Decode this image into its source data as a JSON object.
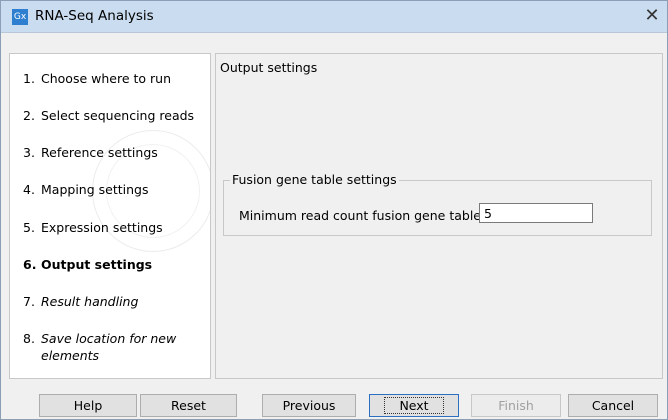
{
  "window": {
    "app_logo": "Gx",
    "title": "RNA-Seq Analysis",
    "close": "✕"
  },
  "steps": [
    {
      "num": "1.",
      "label": "Choose where to run",
      "state": "done"
    },
    {
      "num": "2.",
      "label": "Select sequencing reads",
      "state": "done"
    },
    {
      "num": "3.",
      "label": "Reference settings",
      "state": "done"
    },
    {
      "num": "4.",
      "label": "Mapping settings",
      "state": "done"
    },
    {
      "num": "5.",
      "label": "Expression settings",
      "state": "done"
    },
    {
      "num": "6.",
      "label": "Output settings",
      "state": "current"
    },
    {
      "num": "7.",
      "label": "Result handling",
      "state": "future"
    },
    {
      "num": "8.",
      "label": "Save location for new elements",
      "state": "future"
    }
  ],
  "main": {
    "title": "Output settings",
    "group": {
      "legend": "Fusion gene table settings",
      "field_label": "Minimum read count fusion gene table",
      "field_value": "5"
    }
  },
  "buttons": {
    "help": "Help",
    "reset": "Reset",
    "previous": "Previous",
    "next": "Next",
    "finish": "Finish",
    "cancel": "Cancel"
  }
}
